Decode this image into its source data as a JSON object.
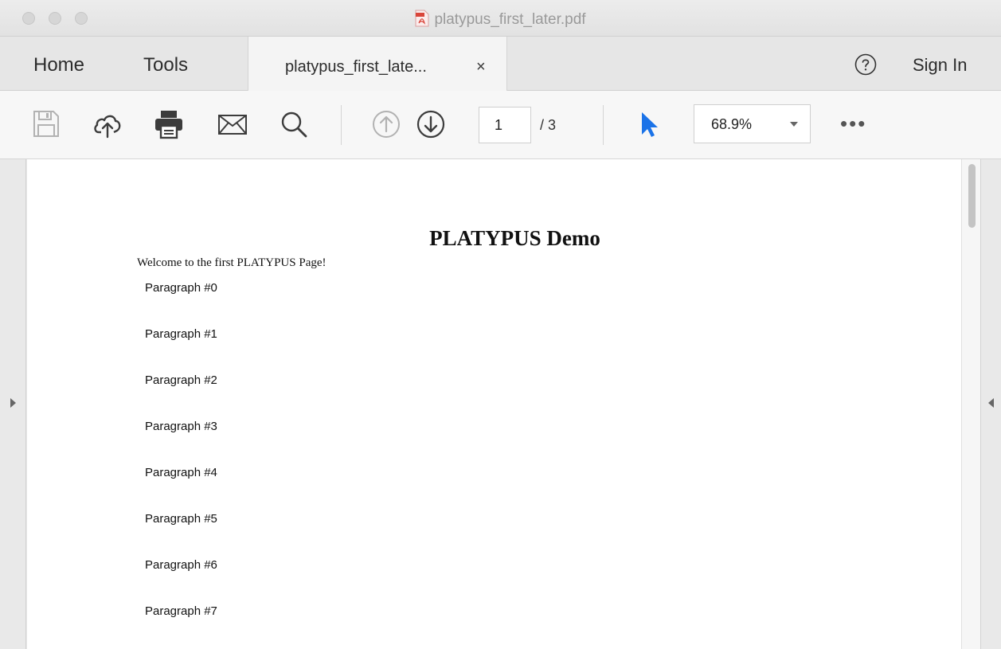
{
  "window": {
    "title": "platypus_first_later.pdf",
    "title_icon": "pdf-file-icon"
  },
  "tabs": {
    "home": "Home",
    "tools": "Tools",
    "document_tab": "platypus_first_late...",
    "close_symbol": "×",
    "sign_in": "Sign In",
    "help_icon": "help-circle-icon"
  },
  "toolbar": {
    "icons": [
      "save-icon",
      "upload-cloud-icon",
      "print-icon",
      "email-icon",
      "search-icon",
      "previous-page-icon",
      "next-page-icon",
      "select-pointer-icon"
    ],
    "current_page": "1",
    "page_total": "/ 3",
    "zoom": "68.9%",
    "more": "•••",
    "pointer_color": "#1b73e8"
  },
  "document": {
    "heading": "PLATYPUS Demo",
    "welcome": "Welcome to the first PLATYPUS Page!",
    "paragraphs": [
      "Paragraph #0",
      "Paragraph #1",
      "Paragraph #2",
      "Paragraph #3",
      "Paragraph #4",
      "Paragraph #5",
      "Paragraph #6",
      "Paragraph #7"
    ]
  }
}
